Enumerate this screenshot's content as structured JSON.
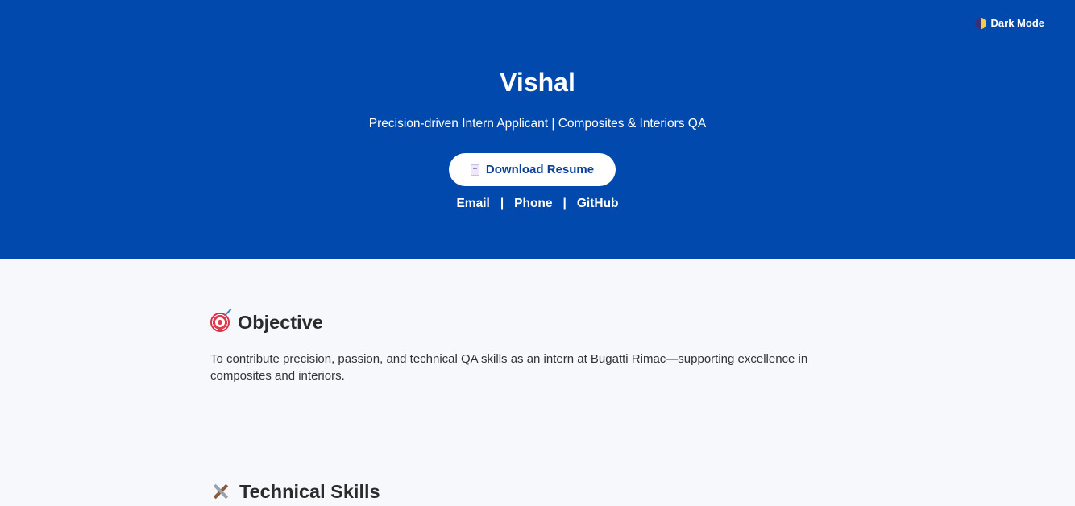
{
  "header": {
    "dark_mode_label": "Dark Mode",
    "dark_mode_icon": "half-moon-icon",
    "name": "Vishal",
    "tagline": "Precision-driven Intern Applicant | Composites & Interiors QA",
    "resume_button_label": "Download Resume",
    "resume_button_icon": "document-icon",
    "contacts": [
      {
        "label": "Email"
      },
      {
        "label": "Phone"
      },
      {
        "label": "GitHub"
      }
    ],
    "separator": "|"
  },
  "sections": {
    "objective": {
      "icon": "target-icon",
      "title": "Objective",
      "text": "To contribute precision, passion, and technical QA skills as an intern at Bugatti Rimac—supporting excellence in composites and interiors."
    },
    "skills": {
      "icon": "tools-icon",
      "title": "Technical Skills"
    }
  },
  "colors": {
    "hero_background": "#0149ad",
    "page_background": "#f6f8fc",
    "button_text": "#0a3f9a",
    "heading_text": "#2b2b2b"
  }
}
